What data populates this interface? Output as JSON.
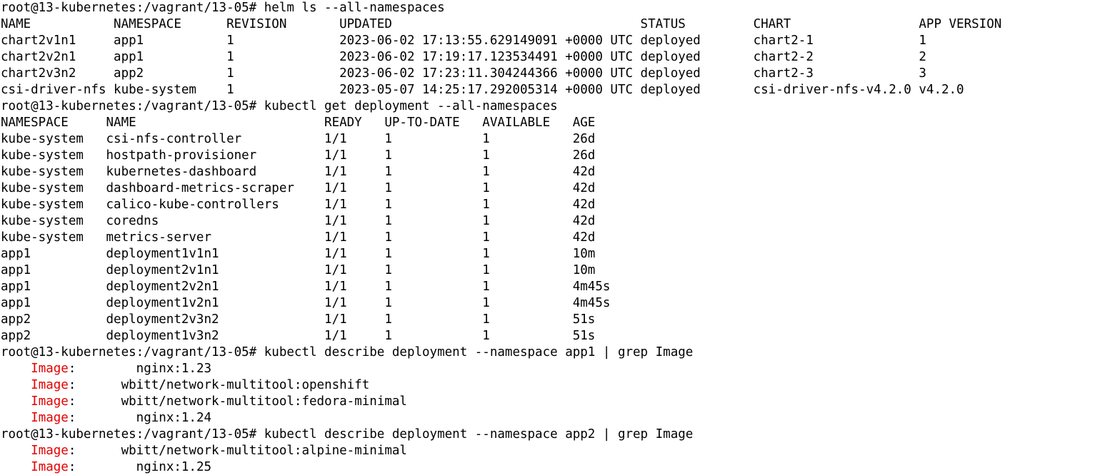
{
  "colors": {
    "background": "#ffffff",
    "text": "#000000",
    "grep_highlight": "#e50000"
  },
  "terminal": {
    "lines": [
      {
        "type": "text",
        "text": "root@13-kubernetes:/vagrant/13-05# helm ls --all-namespaces"
      },
      {
        "type": "text",
        "text": "NAME           NAMESPACE      REVISION       UPDATED                                 STATUS         CHART                 APP VERSION"
      },
      {
        "type": "text",
        "text": "chart2v1n1     app1           1              2023-06-02 17:13:55.629149091 +0000 UTC deployed       chart2-1              1"
      },
      {
        "type": "text",
        "text": "chart2v2n1     app1           1              2023-06-02 17:19:17.123534491 +0000 UTC deployed       chart2-2              2"
      },
      {
        "type": "text",
        "text": "chart2v3n2     app2           1              2023-06-02 17:23:11.304244366 +0000 UTC deployed       chart2-3              3"
      },
      {
        "type": "text",
        "text": "csi-driver-nfs kube-system    1              2023-05-07 14:25:17.292005314 +0000 UTC deployed       csi-driver-nfs-v4.2.0 v4.2.0"
      },
      {
        "type": "text",
        "text": "root@13-kubernetes:/vagrant/13-05# kubectl get deployment --all-namespaces"
      },
      {
        "type": "text",
        "text": "NAMESPACE     NAME                         READY   UP-TO-DATE   AVAILABLE   AGE"
      },
      {
        "type": "text",
        "text": "kube-system   csi-nfs-controller           1/1     1            1           26d"
      },
      {
        "type": "text",
        "text": "kube-system   hostpath-provisioner         1/1     1            1           26d"
      },
      {
        "type": "text",
        "text": "kube-system   kubernetes-dashboard         1/1     1            1           42d"
      },
      {
        "type": "text",
        "text": "kube-system   dashboard-metrics-scraper    1/1     1            1           42d"
      },
      {
        "type": "text",
        "text": "kube-system   calico-kube-controllers      1/1     1            1           42d"
      },
      {
        "type": "text",
        "text": "kube-system   coredns                      1/1     1            1           42d"
      },
      {
        "type": "text",
        "text": "kube-system   metrics-server               1/1     1            1           42d"
      },
      {
        "type": "text",
        "text": "app1          deployment1v1n1              1/1     1            1           10m"
      },
      {
        "type": "text",
        "text": "app1          deployment2v1n1              1/1     1            1           10m"
      },
      {
        "type": "text",
        "text": "app1          deployment2v2n1              1/1     1            1           4m45s"
      },
      {
        "type": "text",
        "text": "app1          deployment1v2n1              1/1     1            1           4m45s"
      },
      {
        "type": "text",
        "text": "app2          deployment2v3n2              1/1     1            1           51s"
      },
      {
        "type": "text",
        "text": "app2          deployment1v3n2              1/1     1            1           51s"
      },
      {
        "type": "text",
        "text": "root@13-kubernetes:/vagrant/13-05# kubectl describe deployment --namespace app1 | grep Image"
      },
      {
        "type": "image",
        "indent": "    ",
        "key": "Image",
        "sep": ":",
        "value": "        nginx:1.23"
      },
      {
        "type": "image",
        "indent": "    ",
        "key": "Image",
        "sep": ":",
        "value": "      wbitt/network-multitool:openshift"
      },
      {
        "type": "image",
        "indent": "    ",
        "key": "Image",
        "sep": ":",
        "value": "      wbitt/network-multitool:fedora-minimal"
      },
      {
        "type": "image",
        "indent": "    ",
        "key": "Image",
        "sep": ":",
        "value": "        nginx:1.24"
      },
      {
        "type": "text",
        "text": "root@13-kubernetes:/vagrant/13-05# kubectl describe deployment --namespace app2 | grep Image"
      },
      {
        "type": "image",
        "indent": "    ",
        "key": "Image",
        "sep": ":",
        "value": "      wbitt/network-multitool:alpine-minimal"
      },
      {
        "type": "image",
        "indent": "    ",
        "key": "Image",
        "sep": ":",
        "value": "        nginx:1.25"
      }
    ]
  }
}
